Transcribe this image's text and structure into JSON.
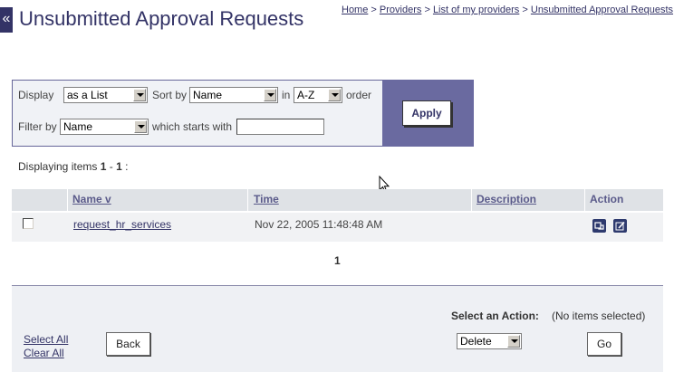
{
  "header": {
    "collapse_glyph": "«",
    "title": "Unsubmitted Approval Requests",
    "breadcrumb": {
      "home": "Home",
      "providers": "Providers",
      "my_providers": "List of my providers",
      "current": "Unsubmitted Approval Requests",
      "separator": ">"
    }
  },
  "filter": {
    "display_label": "Display",
    "display_value": "as a List",
    "sort_label": "Sort by",
    "sort_value": "Name",
    "in_label": "in",
    "order_value": "A-Z",
    "order_label": "order",
    "filter_label": "Filter by",
    "filter_value": "Name",
    "starts_label": "which starts with",
    "starts_value": "",
    "apply_label": "Apply"
  },
  "summary": {
    "prefix": "Displaying items ",
    "range_start": "1",
    "range_sep": " - ",
    "range_end": "1",
    "suffix": " :"
  },
  "table": {
    "columns": {
      "name": "Name v",
      "time": "Time",
      "description": "Description",
      "action": "Action"
    },
    "rows": [
      {
        "name": "request_hr_services",
        "time": "Nov 22, 2005 11:48:48 AM",
        "description": "",
        "checked": false
      }
    ]
  },
  "pagination": {
    "current_page": "1"
  },
  "actions": {
    "select_action_label": "Select an Action:",
    "selection_status": "(No items selected)",
    "action_value": "Delete",
    "go_label": "Go",
    "select_all": "Select All",
    "clear_all": "Clear All",
    "back_label": "Back"
  },
  "colors": {
    "primary": "#333366",
    "panel_accent": "#6a6aa0",
    "header_bg": "#dfe2e6"
  },
  "icons": {
    "row_action_1": "preview-icon",
    "row_action_2": "edit-icon",
    "cursor": "mouse-pointer-icon"
  }
}
